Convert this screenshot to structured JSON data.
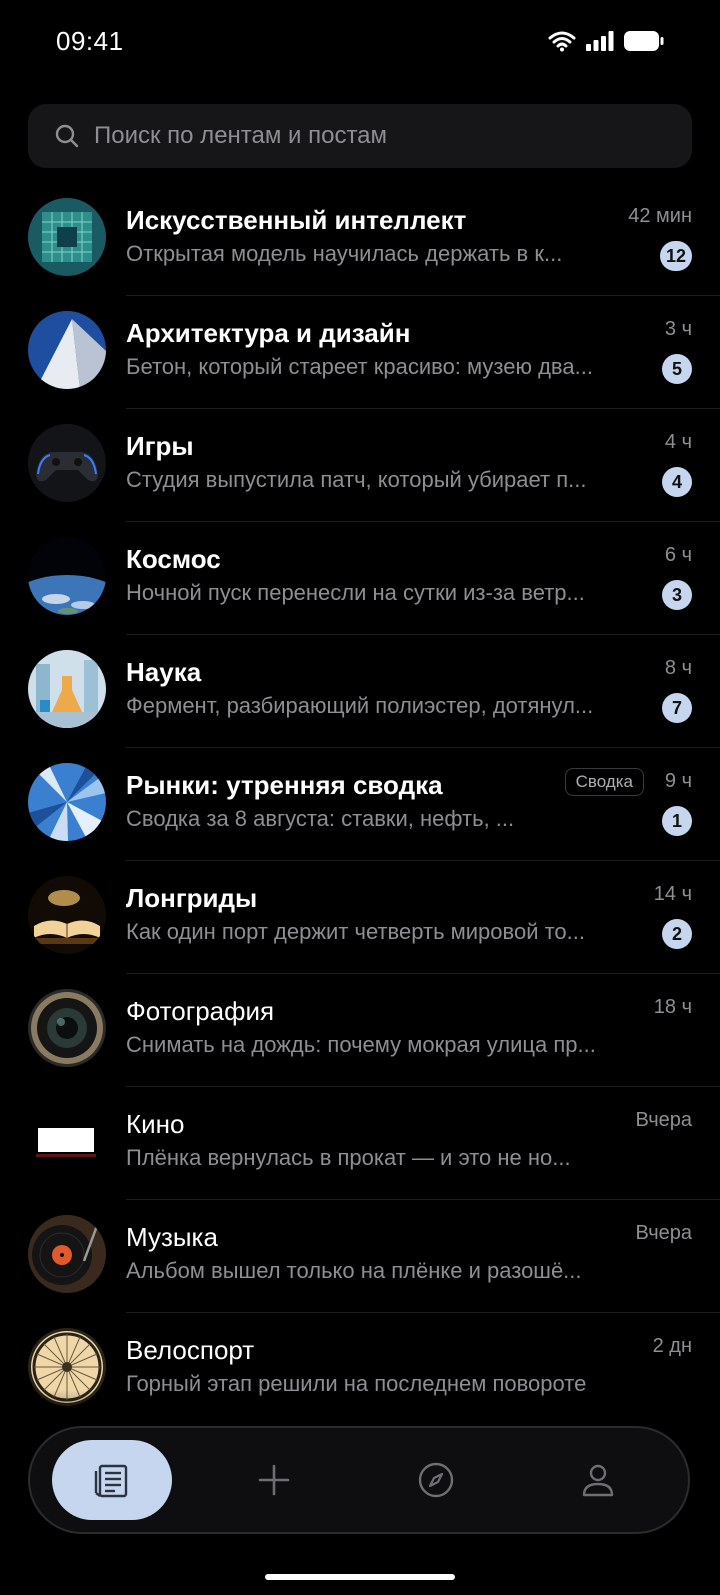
{
  "status": {
    "time": "09:41"
  },
  "search": {
    "placeholder": "Поиск по лентам и постам"
  },
  "feeds": [
    {
      "title": "Искусственный интеллект",
      "preview": "Открытая модель научилась держать в к...",
      "time": "42 мин",
      "badge": "12",
      "bold": true,
      "avatar": "chip-image"
    },
    {
      "title": "Архитектура и дизайн",
      "preview": "Бетон, который стареет красиво: музею два...",
      "time": "3 ч",
      "badge": "5",
      "bold": true,
      "avatar": "building-image"
    },
    {
      "title": "Игры",
      "preview": "Студия выпустила патч, который убирает п...",
      "time": "4 ч",
      "badge": "4",
      "bold": true,
      "avatar": "gamepad-image"
    },
    {
      "title": "Космос",
      "preview": "Ночной пуск перенесли на сутки из-за ветр...",
      "time": "6 ч",
      "badge": "3",
      "bold": true,
      "avatar": "earth-image"
    },
    {
      "title": "Наука",
      "preview": "Фермент, разбирающий полиэстер, дотянул...",
      "time": "8 ч",
      "badge": "7",
      "bold": true,
      "avatar": "lab-image"
    },
    {
      "title": "Рынки: утренняя сводка",
      "preview": "Сводка за 8 августа: ставки, нефть, ...",
      "time": "9 ч",
      "badge": "1",
      "tag": "Сводка",
      "bold": true,
      "avatar": "skyscraper-image"
    },
    {
      "title": "Лонгриды",
      "preview": "Как один порт держит четверть мировой то...",
      "time": "14 ч",
      "badge": "2",
      "bold": true,
      "avatar": "book-image"
    },
    {
      "title": "Фотография",
      "preview": "Снимать на дождь: почему мокрая улица пр...",
      "time": "18 ч",
      "badge": "",
      "bold": false,
      "avatar": "camera-lens-image"
    },
    {
      "title": "Кино",
      "preview": "Плёнка вернулась в прокат — и это не но...",
      "time": "Вчера",
      "badge": "",
      "bold": false,
      "avatar": "cinema-screen-image"
    },
    {
      "title": "Музыка",
      "preview": "Альбом вышел только на плёнке и разошё...",
      "time": "Вчера",
      "badge": "",
      "bold": false,
      "avatar": "vinyl-image"
    },
    {
      "title": "Велоспорт",
      "preview": "Горный этап решили на последнем повороте",
      "time": "2 дн",
      "badge": "",
      "bold": false,
      "avatar": "wheel-image"
    }
  ],
  "tabbar": {
    "tabs": [
      {
        "name": "feeds-tab",
        "icon": "feed-list-icon",
        "active": true
      },
      {
        "name": "add-tab",
        "icon": "plus-icon",
        "active": false
      },
      {
        "name": "explore-tab",
        "icon": "compass-icon",
        "active": false
      },
      {
        "name": "profile-tab",
        "icon": "person-icon",
        "active": false
      }
    ]
  },
  "colors": {
    "accent": "#c5d6ee",
    "background": "#000000",
    "secondary_text": "#8e8e93"
  }
}
